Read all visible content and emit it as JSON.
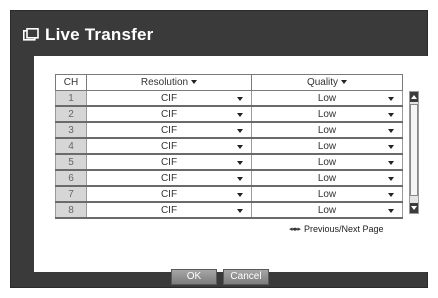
{
  "dialog": {
    "title": "Live Transfer"
  },
  "table": {
    "headers": {
      "ch": "CH",
      "resolution": "Resolution",
      "quality": "Quality"
    },
    "rows": [
      {
        "ch": "1",
        "resolution": "CIF",
        "quality": "Low"
      },
      {
        "ch": "2",
        "resolution": "CIF",
        "quality": "Low"
      },
      {
        "ch": "3",
        "resolution": "CIF",
        "quality": "Low"
      },
      {
        "ch": "4",
        "resolution": "CIF",
        "quality": "Low"
      },
      {
        "ch": "5",
        "resolution": "CIF",
        "quality": "Low"
      },
      {
        "ch": "6",
        "resolution": "CIF",
        "quality": "Low"
      },
      {
        "ch": "7",
        "resolution": "CIF",
        "quality": "Low"
      },
      {
        "ch": "8",
        "resolution": "CIF",
        "quality": "Low"
      }
    ]
  },
  "pager": {
    "label": "Previous/Next Page",
    "nav_glyph": "◂◂ ▸▸"
  },
  "footer": {
    "ok_label": "OK",
    "cancel_label": "Cancel"
  },
  "icons": {
    "title": "window-icon",
    "dropdown": "chevron-down-icon"
  },
  "colors": {
    "dialog_background": "#3a3a3a",
    "channel_cell": "#d6d6d6",
    "button": "#8f8f8f"
  }
}
